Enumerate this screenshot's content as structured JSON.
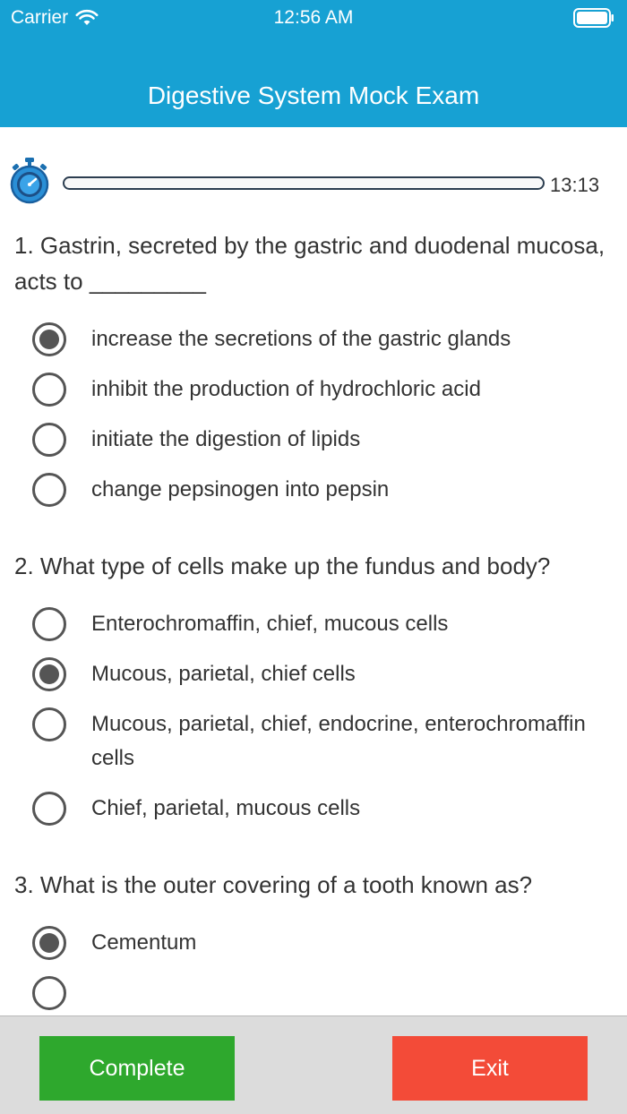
{
  "status_bar": {
    "carrier": "Carrier",
    "time": "12:56 AM"
  },
  "header": {
    "title": "Digestive System Mock Exam"
  },
  "timer": {
    "remaining": "13:13",
    "progress": 0.0
  },
  "questions": [
    {
      "text": "1. Gastrin, secreted by the gastric and duodenal mucosa, acts to _________",
      "options": [
        "increase the secretions of the gastric glands",
        "inhibit the production of hydrochloric acid",
        "initiate the digestion of lipids",
        "change pepsinogen into pepsin"
      ],
      "selected": 0
    },
    {
      "text": "2. What type of cells make up the fundus and body?",
      "options": [
        "Enterochromaffin, chief, mucous cells",
        "Mucous, parietal, chief cells",
        "Mucous, parietal, chief, endocrine, enterochromaffin cells",
        "Chief, parietal, mucous cells"
      ],
      "selected": 1
    },
    {
      "text": "3. What is the outer covering of a tooth known as?",
      "options": [
        "Cementum"
      ],
      "selected": 0
    }
  ],
  "footer": {
    "complete_label": "Complete",
    "exit_label": "Exit"
  },
  "colors": {
    "header": "#17a1d3",
    "complete": "#2ea82d",
    "exit": "#f34b38"
  }
}
